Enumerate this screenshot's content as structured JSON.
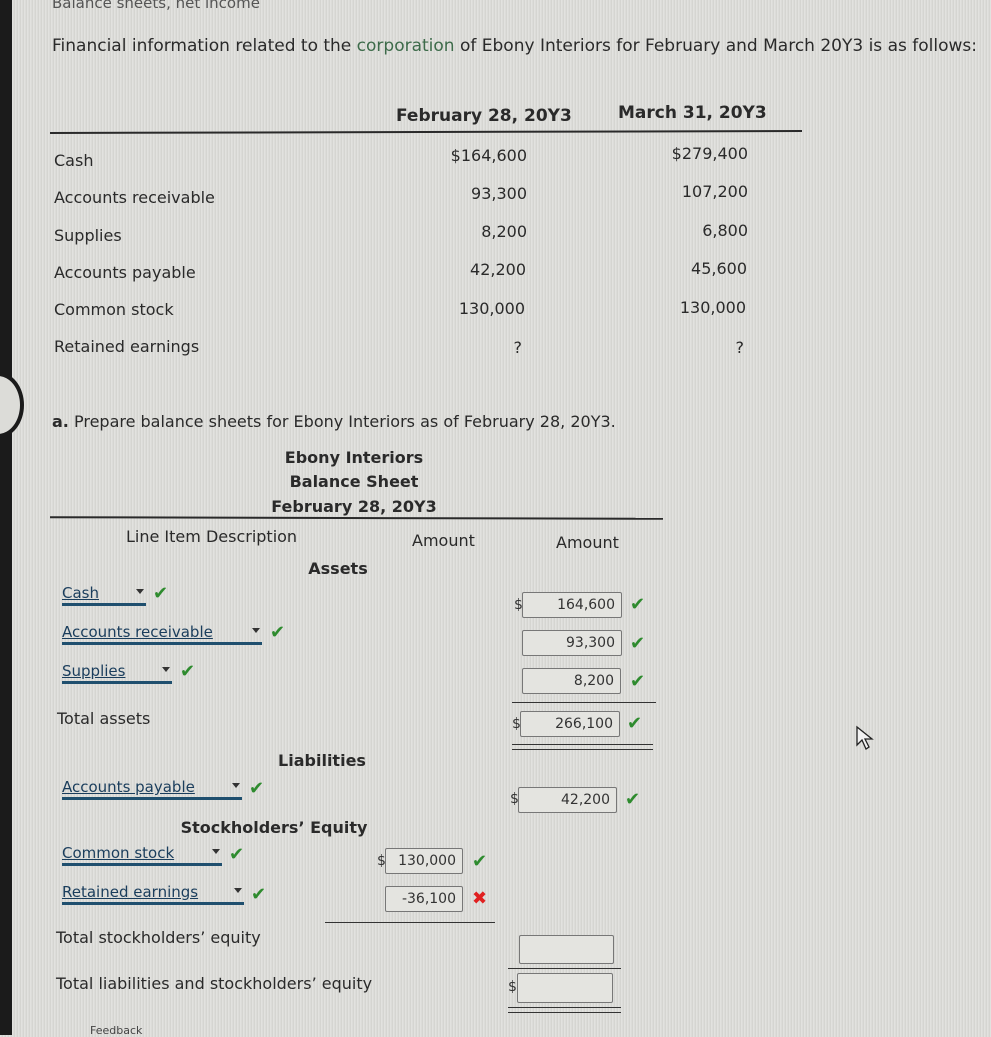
{
  "topic": "Balance sheets, net income",
  "intro": {
    "before": "Financial information related to the ",
    "link": "corporation",
    "after": " of Ebony Interiors for February and March 20Y3 is as follows:"
  },
  "info_table": {
    "columns": [
      "February 28, 20Y3",
      "March 31, 20Y3"
    ],
    "rows": [
      {
        "label": "Cash",
        "feb": "$164,600",
        "mar": "$279,400"
      },
      {
        "label": "Accounts receivable",
        "feb": "93,300",
        "mar": "107,200"
      },
      {
        "label": "Supplies",
        "feb": "8,200",
        "mar": "6,800"
      },
      {
        "label": "Accounts payable",
        "feb": "42,200",
        "mar": "45,600"
      },
      {
        "label": "Common stock",
        "feb": "130,000",
        "mar": "130,000"
      },
      {
        "label": "Retained earnings",
        "feb": "?",
        "mar": "?"
      }
    ]
  },
  "question": {
    "letter": "a.",
    "text": "Prepare balance sheets for Ebony Interiors as of February 28, 20Y3."
  },
  "balance_sheet": {
    "company": "Ebony Interiors",
    "title": "Balance Sheet",
    "date": "February 28, 20Y3",
    "col_headers": {
      "description": "Line Item Description",
      "amount1": "Amount",
      "amount2": "Amount"
    },
    "sections": {
      "assets": "Assets",
      "liabilities": "Liabilities",
      "equity": "Stockholders’ Equity"
    },
    "assets": [
      {
        "select": "Cash",
        "value": "164,600",
        "status": "correct"
      },
      {
        "select": "Accounts receivable",
        "value": "93,300",
        "status": "correct"
      },
      {
        "select": "Supplies",
        "value": "8,200",
        "status": "correct"
      }
    ],
    "total_assets": {
      "label": "Total assets",
      "value": "266,100",
      "status": "correct"
    },
    "liabilities": [
      {
        "select": "Accounts payable",
        "value": "42,200",
        "status": "correct"
      }
    ],
    "equity": [
      {
        "select": "Common stock",
        "value": "130,000",
        "status": "correct"
      },
      {
        "select": "Retained earnings",
        "value": "-36,100",
        "status": "incorrect"
      }
    ],
    "total_equity": {
      "label": "Total stockholders’ equity",
      "value": ""
    },
    "total_liab_equity": {
      "label": "Total liabilities and stockholders’ equity",
      "value": ""
    }
  },
  "symbols": {
    "dollar": "$",
    "check": "✔",
    "cross": "✖",
    "question": "?"
  },
  "colors": {
    "check": "#2e8b2e",
    "cross": "#e02020",
    "select_underline": "#1f4f6e"
  },
  "feedback_label": "Feedback"
}
